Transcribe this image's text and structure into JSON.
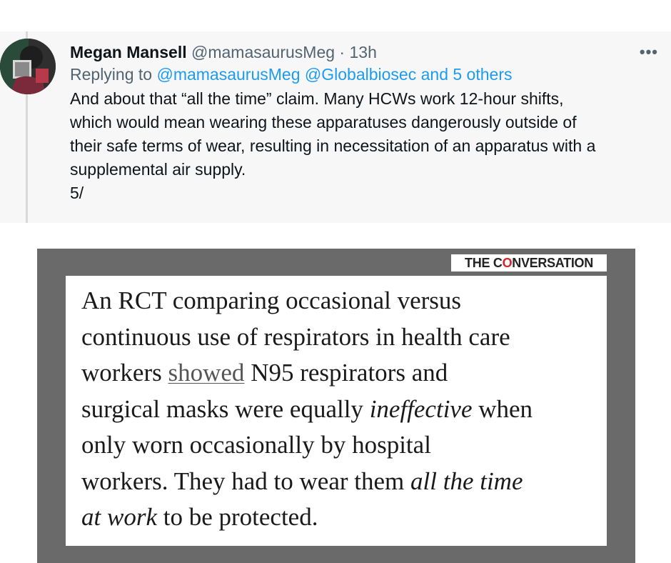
{
  "tweet": {
    "author_name": "Megan Mansell",
    "author_handle": "@mamasaurusMeg",
    "separator": "·",
    "timestamp": "13h",
    "more_label": "•••",
    "reply": {
      "prefix": "Replying to",
      "mention_1": "@mamasaurusMeg",
      "mention_2": "@Globalbiosec",
      "others": "and 5 others"
    },
    "text_lines": [
      "And about that “all the time” claim. Many HCWs work 12-hour shifts,",
      "which would mean wearing these apparatuses dangerously outside of",
      "their safe terms of wear, resulting in necessitation of an apparatus with a",
      "supplemental air supply.",
      "5/"
    ]
  },
  "media": {
    "brand_left": "THE C",
    "brand_mark": "O",
    "brand_right": "NVERSATION",
    "quote": {
      "l1": "An RCT comparing occasional versus",
      "l2": "continuous use of respirators in health care",
      "l3_a": "workers ",
      "l3_link": "showed",
      "l3_b": " N95 respirators and",
      "l4_a": "surgical masks were equally ",
      "l4_em": "ineffective",
      "l4_b": " when",
      "l5": "only worn occasionally by hospital",
      "l6_a": "workers. They had to wear them ",
      "l6_em": "all the time",
      "l7_em": "at work",
      "l7_b": " to be protected."
    }
  },
  "colors": {
    "link": "#1d9bf0",
    "muted": "#536471",
    "tweet_bg": "#f7f7f7",
    "media_frame": "#6a6a6a",
    "brand_accent": "#d8232a"
  },
  "icons": {
    "avatar": "user-avatar",
    "more": "more-icon"
  }
}
